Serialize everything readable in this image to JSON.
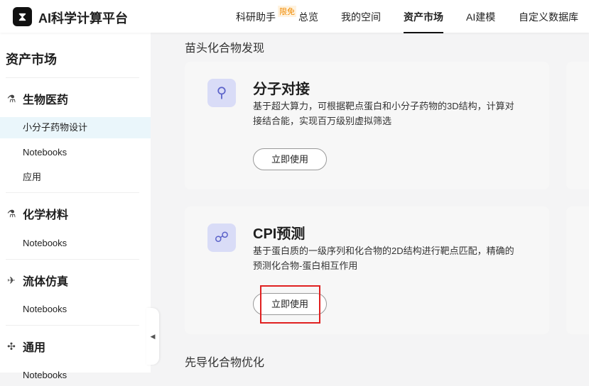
{
  "header": {
    "logo_icon": "hourglass-icon",
    "brand": "AI科学计算平台",
    "nav": [
      "科研助手",
      "总览",
      "我的空间",
      "资产市场",
      "AI建模",
      "自定义数据库"
    ],
    "badge": "限免",
    "active": "资产市场"
  },
  "sidebar": {
    "title": "资产市场",
    "sections": [
      {
        "label": "生物医药",
        "icon": "bio-icon",
        "items": [
          "小分子药物设计",
          "Notebooks",
          "应用"
        ]
      },
      {
        "label": "化学材料",
        "icon": "flask-icon",
        "items": [
          "Notebooks"
        ]
      },
      {
        "label": "流体仿真",
        "icon": "plane-icon",
        "items": [
          "Notebooks"
        ]
      },
      {
        "label": "通用",
        "icon": "network-icon",
        "items": [
          "Notebooks"
        ]
      }
    ],
    "selected": "小分子药物设计"
  },
  "main": {
    "section1": "苗头化合物发现",
    "section2": "先导化合物优化",
    "cards": [
      {
        "title": "分子对接",
        "desc": "基于超大算力，可根据靶点蛋白和小分子药物的3D结构，计算对接结合能，实现百万级别虚拟筛选",
        "button": "立即使用"
      },
      {
        "title": "CPI预测",
        "desc": "基于蛋白质的一级序列和化合物的2D结构进行靶点匹配，精确的预测化合物-蛋白相互作用",
        "button": "立即使用"
      }
    ]
  }
}
